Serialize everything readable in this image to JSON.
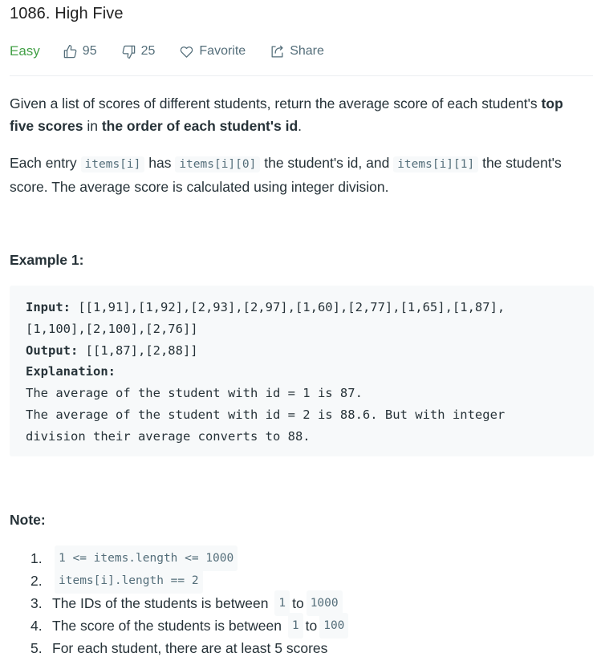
{
  "problem": {
    "title": "1086. High Five",
    "difficulty": "Easy",
    "likes": "95",
    "dislikes": "25",
    "favorite_label": "Favorite",
    "share_label": "Share"
  },
  "description": {
    "p1": {
      "t1": "Given a list of scores of different students, return the average score of each student's ",
      "b1": "top five scores",
      "t2": " in ",
      "b2": "the order of each student's id",
      "t3": "."
    },
    "p2": {
      "t1": "Each entry ",
      "c1": "items[i]",
      "t2": " has ",
      "c2": "items[i][0]",
      "t3": " the student's id, and ",
      "c3": "items[i][1]",
      "t4": " the student's score.  The average score is calculated using integer division."
    }
  },
  "example": {
    "heading": "Example 1:",
    "input_label": "Input:",
    "input_line1": " [[1,91],[1,92],[2,93],[2,97],[1,60],[2,77],[1,65],[1,87],",
    "input_line2": "[1,100],[2,100],[2,76]]",
    "output_label": "Output:",
    "output_value": " [[1,87],[2,88]]",
    "explanation_label": "Explanation:",
    "explanation_line1": "The average of the student with id = 1 is 87.",
    "explanation_line2": "The average of the student with id = 2 is 88.6. But with integer",
    "explanation_line3": "division their average converts to 88."
  },
  "note": {
    "heading": "Note:",
    "items": [
      {
        "num": "1.",
        "code1": "1 <= items.length <= 1000"
      },
      {
        "num": "2.",
        "code1": "items[i].length == 2"
      },
      {
        "num": "3.",
        "text1": "The IDs of the students is between",
        "code1": "1",
        "text2": "to",
        "code2": "1000"
      },
      {
        "num": "4.",
        "text1": "The score of the students is between",
        "code1": "1",
        "text2": "to",
        "code2": "100"
      },
      {
        "num": "5.",
        "text1": "For each student, there are at least 5 scores"
      }
    ]
  },
  "colors": {
    "easy": "#43a047",
    "code_bg": "#f7f9fa",
    "text": "#263238",
    "muted": "#546e7a"
  },
  "icons": [
    "thumbs-up-icon",
    "thumbs-down-icon",
    "heart-icon",
    "share-icon"
  ]
}
